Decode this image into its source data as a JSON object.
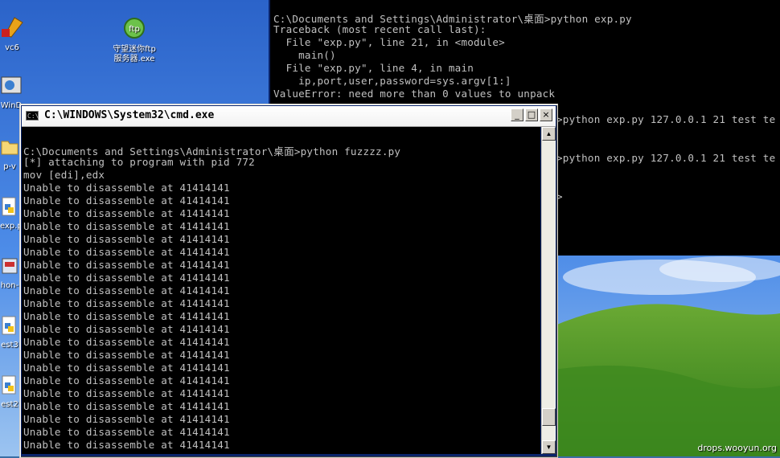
{
  "desktop": {
    "icons": [
      {
        "label": "vc6"
      },
      {
        "label": "守望迷你ftp\n服务器.exe"
      },
      {
        "label": "WinD"
      },
      {
        "label": "p-v"
      },
      {
        "label": "exp.p"
      },
      {
        "label": "hon-"
      },
      {
        "label": "est3"
      },
      {
        "label": "est2"
      }
    ],
    "watermark": "drops.wooyun.org"
  },
  "back_console": {
    "lines": [
      "C:\\Documents and Settings\\Administrator\\桌面>python exp.py",
      "Traceback (most recent call last):",
      "  File \"exp.py\", line 21, in <module>",
      "    main()",
      "  File \"exp.py\", line 4, in main",
      "    ip,port,user,password=sys.argv[1:]",
      "ValueError: need more than 0 values to unpack",
      ">python exp.py 127.0.0.1 21 test te",
      ">python exp.py 127.0.0.1 21 test te",
      ">"
    ]
  },
  "cmd_window": {
    "title": "C:\\WINDOWS\\System32\\cmd.exe",
    "sysicon_label": "C:\\",
    "minimize_glyph": "_",
    "maximize_glyph": "□",
    "close_glyph": "×",
    "lines": [
      "C:\\Documents and Settings\\Administrator\\桌面>python fuzzzz.py",
      "[*] attaching to program with pid 772",
      "mov [edi],edx",
      "Unable to disassemble at 41414141",
      "Unable to disassemble at 41414141",
      "Unable to disassemble at 41414141",
      "Unable to disassemble at 41414141",
      "Unable to disassemble at 41414141",
      "Unable to disassemble at 41414141",
      "Unable to disassemble at 41414141",
      "Unable to disassemble at 41414141",
      "Unable to disassemble at 41414141",
      "Unable to disassemble at 41414141",
      "Unable to disassemble at 41414141",
      "Unable to disassemble at 41414141",
      "Unable to disassemble at 41414141",
      "Unable to disassemble at 41414141",
      "Unable to disassemble at 41414141",
      "Unable to disassemble at 41414141",
      "Unable to disassemble at 41414141",
      "Unable to disassemble at 41414141",
      "Unable to disassemble at 41414141",
      "Unable to disassemble at 41414141",
      "Unable to disassemble at 41414141"
    ],
    "scroll_up_glyph": "▲",
    "scroll_down_glyph": "▼"
  }
}
